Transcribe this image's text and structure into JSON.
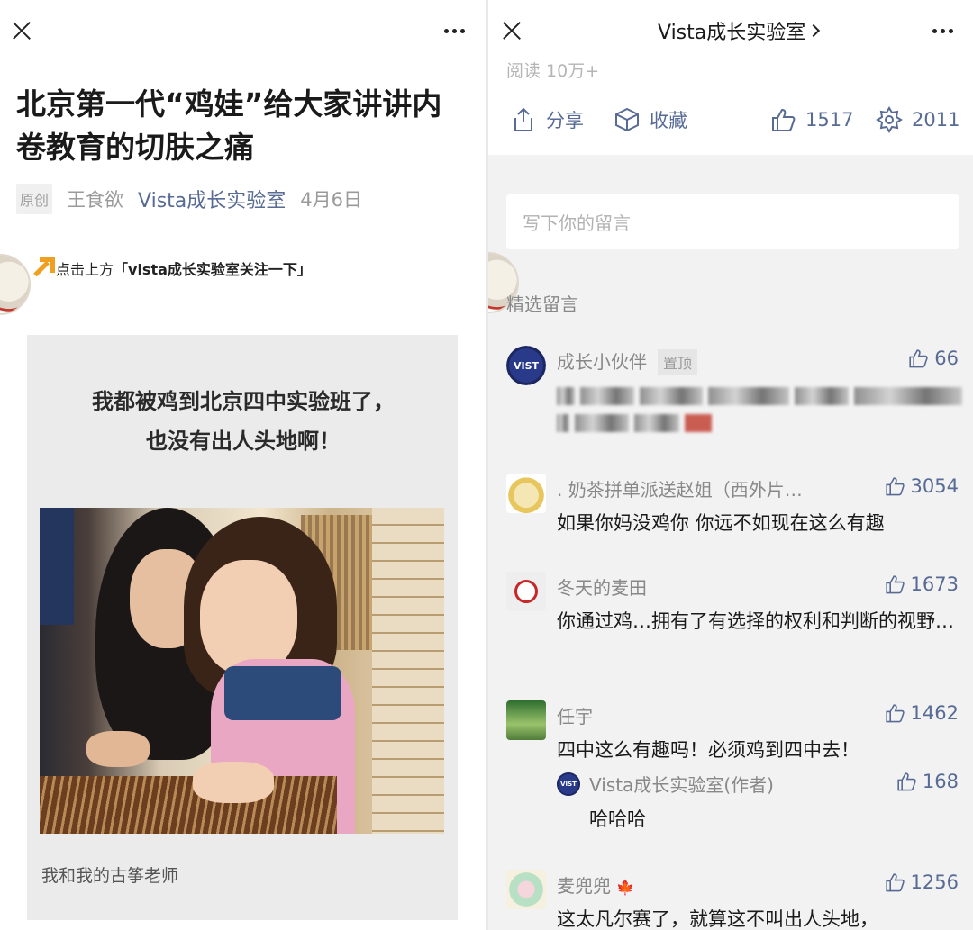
{
  "left": {
    "title": "北京第一代“鸡娃”给大家讲讲内卷教育的切肤之痛",
    "meta": {
      "original_badge": "原创",
      "author": "王食欲",
      "account": "Vista成长实验室",
      "date": "4月6日"
    },
    "follow_prefix": "点击上方",
    "follow_cta": "「vista成长实验室关注一下」",
    "card_headline_line1": "我都被鸡到北京四中实验班了，",
    "card_headline_line2": "也没有出人头地啊！",
    "photo_caption": "我和我的古筝老师"
  },
  "right": {
    "account_title": "Vista成长实验室",
    "reads": "阅读 10万+",
    "actions": {
      "share": "分享",
      "favorite": "收藏",
      "likes": "1517",
      "wow": "2011"
    },
    "comment_placeholder": "写下你的留言",
    "selected_label": "精选留言",
    "comments": [
      {
        "name": "成长小伙伴",
        "pinned": "置顶",
        "likes": "66",
        "text": ""
      },
      {
        "name": ". 奶茶拼单派送赵姐（西外片…",
        "likes": "3054",
        "text": "如果你妈没鸡你 你远不如现在这么有趣"
      },
      {
        "name": "冬天的麦田",
        "likes": "1673",
        "text": "你通过鸡…拥有了有选择的权利和判断的视野…"
      },
      {
        "name": "任宇",
        "likes": "1462",
        "text": "四中这么有趣吗！必须鸡到四中去！",
        "reply": {
          "name": "Vista成长实验室(作者)",
          "likes": "168",
          "text": "哈哈哈"
        }
      },
      {
        "name": "麦兜兜",
        "likes": "1256",
        "text": "这太凡尔赛了，就算这不叫出人头地，"
      }
    ]
  },
  "colors": {
    "link": "#576b95",
    "muted": "#888888",
    "accent_arrow": "#f0a020"
  },
  "icons": [
    "close-icon",
    "more-icon",
    "arrow-up-icon",
    "share-icon",
    "favorite-icon",
    "thumb-up-icon",
    "wow-icon",
    "chevron-right-icon"
  ]
}
